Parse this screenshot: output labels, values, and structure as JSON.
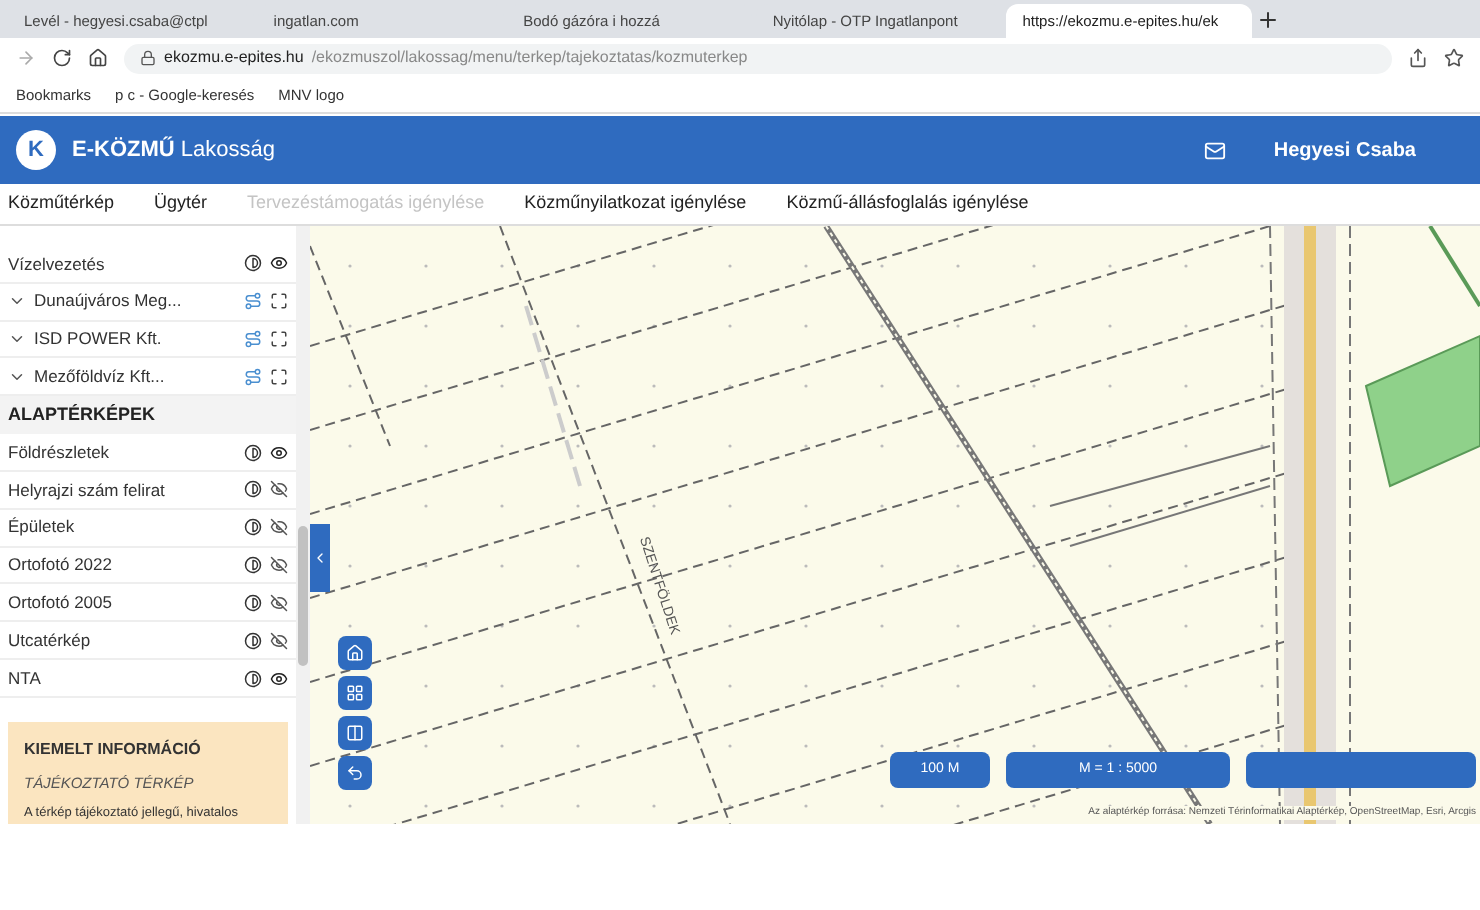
{
  "browser": {
    "tabs": [
      {
        "title": "Levél - hegyesi.csaba@ctpl",
        "selected": false
      },
      {
        "title": "ingatlan.com",
        "selected": false
      },
      {
        "title": "Bodó gázóra i hozzá",
        "selected": false
      },
      {
        "title": "Nyitólap - OTP Ingatlanpont",
        "selected": false
      },
      {
        "title": "https://ekozmu.e-epites.hu/ek",
        "selected": true
      }
    ],
    "url_host": "ekozmu.e-epites.hu",
    "url_path": "/ekozmuszol/lakossag/menu/terkep/tajekoztatas/kozmuterkep",
    "bookmarks": [
      "Bookmarks",
      "p c - Google-keresés",
      "MNV logo"
    ]
  },
  "header": {
    "logo_letter": "K",
    "brand": "E-KÖZMŰ",
    "subtitle": "Lakosság",
    "user": "Hegyesi Csaba"
  },
  "nav": [
    {
      "label": "Közműtérkép",
      "disabled": false
    },
    {
      "label": "Ügytér",
      "disabled": false
    },
    {
      "label": "Tervezéstámogatás igénylése",
      "disabled": true
    },
    {
      "label": "Közműnyilatkozat igénylése",
      "disabled": false
    },
    {
      "label": "Közmű-állásfoglalás igénylése",
      "disabled": false
    }
  ],
  "layers": [
    {
      "kind": "layer",
      "name": "Vízelvezetés",
      "visible": true
    },
    {
      "kind": "group",
      "name": "Dunaújváros Meg..."
    },
    {
      "kind": "group",
      "name": "ISD POWER Kft."
    },
    {
      "kind": "group",
      "name": "Mezőföldvíz Kft..."
    },
    {
      "kind": "heading",
      "name": "ALAPTÉRKÉPEK"
    },
    {
      "kind": "layer",
      "name": "Földrészletek",
      "visible": true
    },
    {
      "kind": "layer",
      "name": "Helyrajzi szám felirat",
      "visible": false
    },
    {
      "kind": "layer",
      "name": "Épületek",
      "visible": false
    },
    {
      "kind": "layer",
      "name": "Ortofotó 2022",
      "visible": false
    },
    {
      "kind": "layer",
      "name": "Ortofotó 2005",
      "visible": false
    },
    {
      "kind": "layer",
      "name": "Utcatérkép",
      "visible": false
    },
    {
      "kind": "layer",
      "name": "NTA",
      "visible": true
    }
  ],
  "info": {
    "title": "KIEMELT INFORMÁCIÓ",
    "subtitle": "TÁJÉKOZTATÓ TÉRKÉP",
    "text": "A térkép tájékoztató jellegű, hivatalos"
  },
  "map": {
    "labels": [
      "SZENTFÖLDEK"
    ],
    "scale_bar": "100 M",
    "scale": "M = 1 : 5000",
    "attribution": "Az alaptérkép forrása: Nemzeti Térinformatikai Alaptérkép, OpenStreetMap, Esri, Arcgis"
  }
}
